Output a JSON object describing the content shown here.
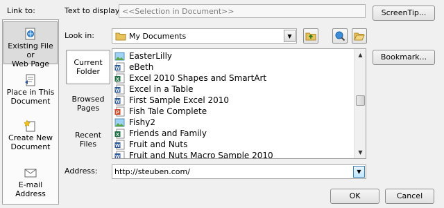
{
  "link_to": {
    "label": "Link to:",
    "items": [
      {
        "label_line1": "Existing File or",
        "label_line2": "Web Page",
        "icon": "web-page-icon"
      },
      {
        "label_line1": "Place in This",
        "label_line2": "Document",
        "icon": "document-place-icon"
      },
      {
        "label_line1": "Create New",
        "label_line2": "Document",
        "icon": "new-document-icon"
      },
      {
        "label_line1": "E-mail Address",
        "label_line2": "",
        "icon": "email-icon"
      }
    ]
  },
  "text_to_display": {
    "label": "Text to display:",
    "value": "<<Selection in Document>>"
  },
  "screentip_button": "ScreenTip...",
  "look_in": {
    "label": "Look in:",
    "value": "My Documents"
  },
  "bookmark_button": "Bookmark...",
  "tabs": [
    {
      "line1": "Current",
      "line2": "Folder"
    },
    {
      "line1": "Browsed",
      "line2": "Pages"
    },
    {
      "line1": "Recent",
      "line2": "Files"
    }
  ],
  "files": [
    {
      "name": "EasterLilly",
      "type": "image"
    },
    {
      "name": "eBeth",
      "type": "word"
    },
    {
      "name": "Excel 2010 Shapes and SmartArt",
      "type": "excel"
    },
    {
      "name": "Excel in a Table",
      "type": "word"
    },
    {
      "name": "First Sample Excel 2010",
      "type": "word"
    },
    {
      "name": "Fish Tale Complete",
      "type": "powerpoint"
    },
    {
      "name": "Fishy2",
      "type": "image"
    },
    {
      "name": "Friends and Family",
      "type": "excel"
    },
    {
      "name": "Fruit and Nuts",
      "type": "word"
    },
    {
      "name": "Fruit and Nuts Macro Sample 2010",
      "type": "word"
    }
  ],
  "address": {
    "label": "Address:",
    "value": "http://steuben.com/"
  },
  "ok_button": "OK",
  "cancel_button": "Cancel",
  "colors": {
    "word": "#2b5797",
    "excel": "#1e7145",
    "powerpoint": "#d24726",
    "folder": "#e8c25a"
  }
}
